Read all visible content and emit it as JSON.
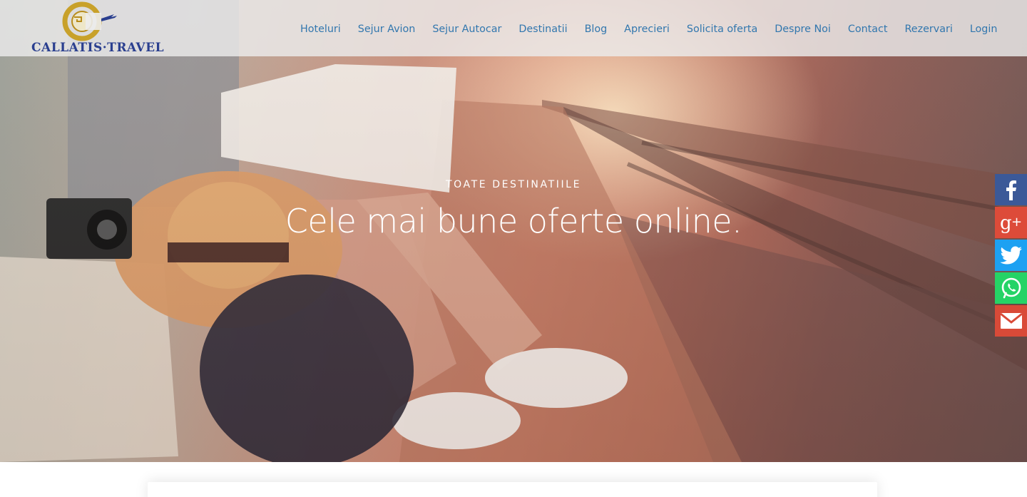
{
  "brand": {
    "name": "CALLATIS·TRAVEL"
  },
  "nav": {
    "items": [
      {
        "label": "Hoteluri"
      },
      {
        "label": "Sejur Avion"
      },
      {
        "label": "Sejur Autocar"
      },
      {
        "label": "Destinatii"
      },
      {
        "label": "Blog"
      },
      {
        "label": "Aprecieri"
      },
      {
        "label": "Solicita oferta"
      },
      {
        "label": "Despre Noi"
      },
      {
        "label": "Contact"
      },
      {
        "label": "Rezervari"
      },
      {
        "label": "Login"
      }
    ]
  },
  "hero": {
    "subtitle": "Toate destinatiile",
    "headline": "Cele mai bune oferte online."
  },
  "social": {
    "items": [
      {
        "name": "facebook-icon",
        "glyph": "f",
        "color": "#3b5998"
      },
      {
        "name": "google-plus-icon",
        "glyph": "g+",
        "color": "#dd4b39"
      },
      {
        "name": "twitter-icon",
        "glyph": "bird",
        "color": "#1da1f2"
      },
      {
        "name": "whatsapp-icon",
        "glyph": "phone",
        "color": "#25d366"
      },
      {
        "name": "email-icon",
        "glyph": "envelope",
        "color": "#d94a38"
      }
    ]
  },
  "colors": {
    "nav_link": "#3277ae",
    "brand_blue": "#2a3f8f",
    "brand_gold": "#c8a12a"
  }
}
